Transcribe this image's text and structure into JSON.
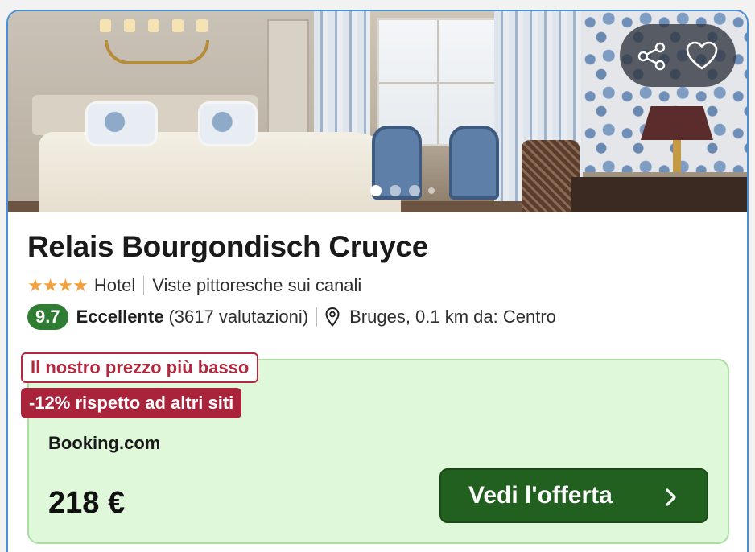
{
  "photo": {
    "carousel": {
      "total_dots": 4,
      "active_index": 0
    }
  },
  "actions": {
    "share_icon": "share-icon",
    "heart_icon": "heart-icon"
  },
  "hotel": {
    "name": "Relais Bourgondisch Cruyce",
    "stars": "★★★★",
    "type": "Hotel",
    "highlight": "Viste pittoresche sui canali",
    "score": "9.7",
    "verdict": "Eccellente",
    "reviews": "(3617 valutazioni)",
    "location": "Bruges, 0.1 km da: Centro"
  },
  "deal": {
    "tag_lowest": "Il nostro prezzo più basso",
    "tag_discount": "-12% rispetto ad altri siti",
    "provider": "Booking.com",
    "price": "218 €",
    "cta_label": "Vedi l'offerta"
  },
  "colors": {
    "accent_border": "#4a90d9",
    "score_green": "#2e7d32",
    "deal_bg": "#dff8da",
    "tag_red": "#a9233b",
    "cta_green": "#22601f",
    "star_orange": "#f4a03b"
  }
}
